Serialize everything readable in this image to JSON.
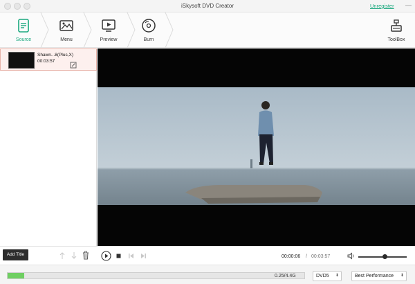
{
  "window": {
    "title": "iSkysoft DVD Creator",
    "unregister": "Unregister",
    "minimize": "—"
  },
  "toolbar": {
    "steps": [
      {
        "label": "Source",
        "icon": "source-icon",
        "active": true
      },
      {
        "label": "Menu",
        "icon": "menu-template-icon",
        "active": false
      },
      {
        "label": "Preview",
        "icon": "preview-icon",
        "active": false
      },
      {
        "label": "Burn",
        "icon": "burn-disc-icon",
        "active": false
      }
    ],
    "toolbox": {
      "label": "ToolBox",
      "icon": "toolbox-icon"
    }
  },
  "source_list": {
    "items": [
      {
        "name": "Shawn...8(Plus,X)",
        "duration": "00:03:57"
      }
    ]
  },
  "controls": {
    "add_title": "Add Title",
    "current_time": "00:00:06",
    "separator": "/",
    "total_time": "00:03:57",
    "volume_fraction": 0.55
  },
  "status": {
    "capacity_text": "0.25/4.4G",
    "capacity_fraction": 0.057,
    "disc_type": "DVD5",
    "quality": "Best Performance"
  },
  "colors": {
    "accent": "#1aa87e",
    "capacity_fill": "#6fcf62",
    "selection_border": "#e8b3a9"
  }
}
